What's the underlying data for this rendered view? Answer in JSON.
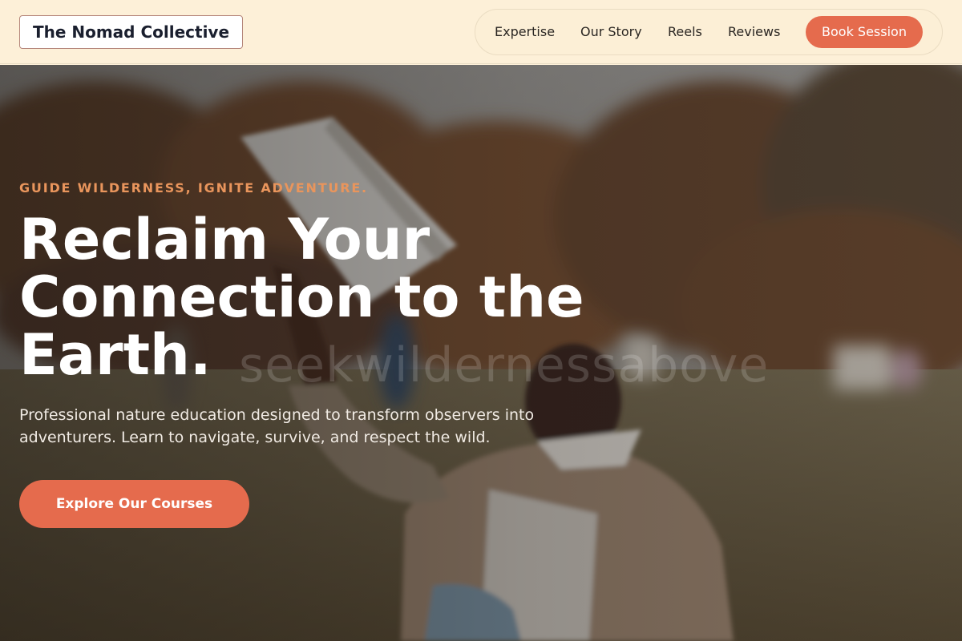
{
  "header": {
    "brand": "The Nomad Collective",
    "nav": [
      {
        "label": "Expertise"
      },
      {
        "label": "Our Story"
      },
      {
        "label": "Reels"
      },
      {
        "label": "Reviews"
      }
    ],
    "cta_label": "Book Session"
  },
  "hero": {
    "eyebrow": "GUIDE WILDERNESS, IGNITE ADVENTURE.",
    "title": "Reclaim Your Connection to the Earth.",
    "description": "Professional nature education designed to transform observers into adventurers. Learn to navigate, survive, and respect the wild.",
    "cta_label": "Explore Our Courses",
    "watermark": "seekwildernessabove"
  },
  "colors": {
    "accent": "#e56b4d",
    "eyebrow": "#e9955c",
    "header_bg": "#fdf0d8",
    "ink": "#1a1f2e"
  }
}
